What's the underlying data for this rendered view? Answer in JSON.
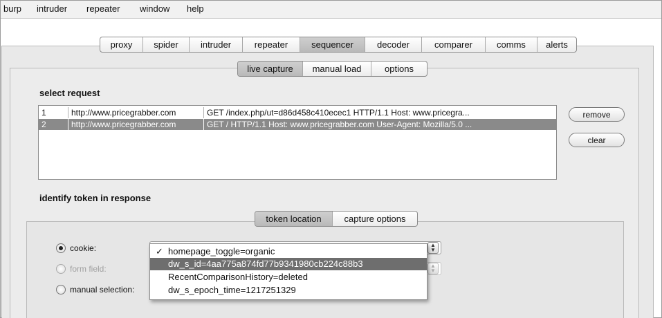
{
  "menubar": [
    "burp",
    "intruder",
    "repeater",
    "window",
    "help"
  ],
  "main_tabs": [
    "proxy",
    "spider",
    "intruder",
    "repeater",
    "sequencer",
    "decoder",
    "comparer",
    "comms",
    "alerts"
  ],
  "main_tabs_active": "sequencer",
  "sub_tabs": [
    "live capture",
    "manual load",
    "options"
  ],
  "sub_tabs_active": "live capture",
  "select_request": {
    "title": "select request",
    "rows": [
      {
        "num": "1",
        "host": "http://www.pricegrabber.com",
        "request": "GET /index.php/ut=d86d458c410ecec1 HTTP/1.1  Host: www.pricegra...",
        "selected": false
      },
      {
        "num": "2",
        "host": "http://www.pricegrabber.com",
        "request": "GET / HTTP/1.1  Host: www.pricegrabber.com  User-Agent: Mozilla/5.0 ...",
        "selected": true
      }
    ],
    "remove_label": "remove",
    "clear_label": "clear"
  },
  "identify": {
    "title": "identify token in response",
    "tabs": [
      "token location",
      "capture options"
    ],
    "tabs_active": "token location",
    "options": [
      {
        "label": "cookie:",
        "checked": true,
        "disabled": false
      },
      {
        "label": "form field:",
        "checked": false,
        "disabled": true
      },
      {
        "label": "manual selection:",
        "checked": false,
        "disabled": false
      }
    ],
    "cookie_dropdown": {
      "check_mark": "✓",
      "items": [
        {
          "label": "homepage_toggle=organic",
          "checked": true,
          "highlight": false
        },
        {
          "label": "dw_s_id=4aa775a874fd77b9341980cb224c88b3",
          "checked": false,
          "highlight": true
        },
        {
          "label": "RecentComparisonHistory=deleted",
          "checked": false,
          "highlight": false
        },
        {
          "label": "dw_s_epoch_time=1217251329",
          "checked": false,
          "highlight": false
        }
      ]
    }
  }
}
